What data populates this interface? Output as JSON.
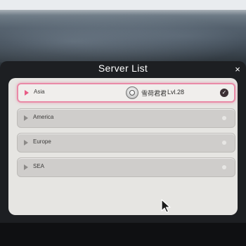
{
  "panel": {
    "title": "Server List",
    "close_label": "×"
  },
  "servers": [
    {
      "name": "Asia",
      "selected": true,
      "player_name": "雪荷君君",
      "player_level": "Lvl.28",
      "status_icon": "check-icon"
    },
    {
      "name": "America",
      "selected": false,
      "status_icon": "dot-icon"
    },
    {
      "name": "Europe",
      "selected": false,
      "status_icon": "dot-icon"
    },
    {
      "name": "SEA",
      "selected": false,
      "status_icon": "dot-icon"
    }
  ],
  "colors": {
    "selected_border": "#e98aa7",
    "selected_arrow": "#e85b86",
    "panel_bg": "#1d1f22",
    "list_bg": "#e6e5e2"
  }
}
